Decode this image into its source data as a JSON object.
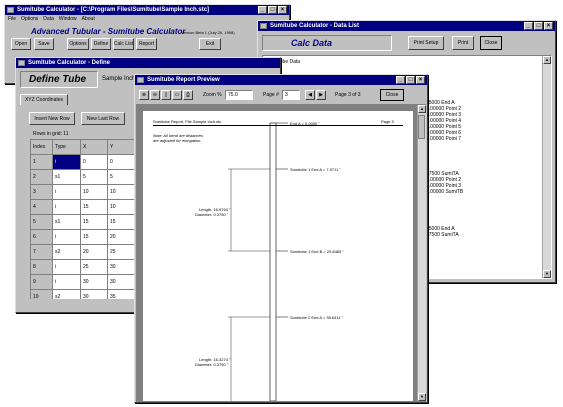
{
  "main_window": {
    "title": "Sumitube Calculator - [C:\\Program Files\\Sumitube\\Sample Inch.stc]",
    "menu": [
      "File",
      "Options",
      "Data",
      "Window",
      "About"
    ],
    "heading": "Advanced Tubular - Sumitube Calculator",
    "version": "Version Beta 1 (July 26, 1998)",
    "buttons": [
      "Open",
      "Save",
      "Options",
      "Define",
      "Calc List",
      "Report"
    ],
    "exit_label": "Exit"
  },
  "define_window": {
    "title": "Sumitube Calculator - Define",
    "heading": "Define Tube",
    "sample_label": "Sample Inch",
    "tab_label": "XYZ Coordinates",
    "insert_label": "Insert New Row",
    "newlast_label": "New Last Row",
    "rows_label": "Rows in grid: 11",
    "columns": [
      "Index",
      "Type",
      "X",
      "Y"
    ],
    "rows": [
      [
        "1",
        "i",
        "0",
        "0"
      ],
      [
        "2",
        "s1",
        "5",
        "5"
      ],
      [
        "3",
        "i",
        "10",
        "10"
      ],
      [
        "4",
        "i",
        "15",
        "10"
      ],
      [
        "5",
        "s1",
        "15",
        "15"
      ],
      [
        "6",
        "i",
        "15",
        "20"
      ],
      [
        "7",
        "s2",
        "20",
        "25"
      ],
      [
        "8",
        "i",
        "25",
        "30"
      ],
      [
        "9",
        "i",
        "30",
        "30"
      ],
      [
        "10",
        "s2",
        "30",
        "35"
      ]
    ]
  },
  "calc_window": {
    "title": "Sumitube Calculator - Data List",
    "heading": "Calc Data",
    "buttons": [
      "Print Setup",
      "Print",
      "Close"
    ],
    "list_title": "Sumitube Data",
    "lines_group1": [
      "75000  End A",
      "0.00000  Point 2",
      "0.00000  Point 3",
      "0.00000  Point 4",
      "0.00000  Point 5",
      "0.00000  Point 6",
      "0.00000  Point 7"
    ],
    "lines_group2": [
      "87500  SumiTA",
      "0.00000  Point 2",
      "0.00000  Point 3",
      "0.00000  SumiTB"
    ],
    "lines_group3": [
      "25000  End A",
      "87500  SumiTA"
    ]
  },
  "preview_window": {
    "title": "Sumitube Report Preview",
    "zoom_label": "Zoom %",
    "zoom_value": "75.0",
    "page_label": "Page #",
    "page_value": "3",
    "page_of": "Page 3 of 3",
    "close_label": "Close",
    "report_header_left": "Sumitube Report, File Sample Inch.stc",
    "report_header_right": "Page 3",
    "note_line1": "Note: All bend are distances",
    "note_line2": "are adjusted for elongation.",
    "labels": {
      "end_a": "End A = 0.0000 \"",
      "s1_end_a": "Sumitube 1  End A = 7.0711 \"",
      "s1_end_b": "Sumitube 1  End B = 20.8465 \"",
      "s2_end_a": "Sumitube 2  End A = 35.6411 \"",
      "length1": "Length:  16.9763 \"",
      "diameter1": "Diameter:  0.3750 \"",
      "length2": "Length:  16.3274 \"",
      "diameter2": "Diameter:  0.3750 \""
    }
  }
}
